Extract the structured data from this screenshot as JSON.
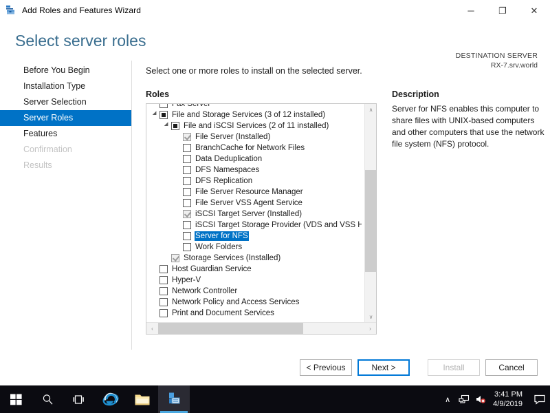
{
  "window": {
    "title": "Add Roles and Features Wizard",
    "icon": "wizard-toolbox-icon",
    "controls": {
      "minimize": "─",
      "restore": "❐",
      "close": "✕"
    }
  },
  "header": {
    "page_title": "Select server roles",
    "destination_label": "DESTINATION SERVER",
    "destination_value": "RX-7.srv.world"
  },
  "sidebar": {
    "items": [
      {
        "label": "Before You Begin",
        "state": "normal"
      },
      {
        "label": "Installation Type",
        "state": "normal"
      },
      {
        "label": "Server Selection",
        "state": "normal"
      },
      {
        "label": "Server Roles",
        "state": "active"
      },
      {
        "label": "Features",
        "state": "normal"
      },
      {
        "label": "Confirmation",
        "state": "disabled"
      },
      {
        "label": "Results",
        "state": "disabled"
      }
    ],
    "active_color": "#0072c6"
  },
  "main": {
    "instruction": "Select one or more roles to install on the selected server.",
    "roles_heading": "Roles",
    "description_heading": "Description",
    "description_text": "Server for NFS enables this computer to share files with UNIX-based computers and other computers that use the network file system (NFS) protocol.",
    "selection_color": "#0072c6"
  },
  "roles_tree": [
    {
      "label": "Fax Server",
      "indent": 0,
      "check": "empty",
      "twisty": false,
      "selected": false,
      "clipped_top": true
    },
    {
      "label": "File and Storage Services (3 of 12 installed)",
      "indent": 0,
      "check": "partial",
      "twisty": true,
      "selected": false
    },
    {
      "label": "File and iSCSI Services (2 of 11 installed)",
      "indent": 1,
      "check": "partial",
      "twisty": true,
      "selected": false
    },
    {
      "label": "File Server (Installed)",
      "indent": 2,
      "check": "installed",
      "twisty": false,
      "selected": false
    },
    {
      "label": "BranchCache for Network Files",
      "indent": 2,
      "check": "empty",
      "twisty": false,
      "selected": false
    },
    {
      "label": "Data Deduplication",
      "indent": 2,
      "check": "empty",
      "twisty": false,
      "selected": false
    },
    {
      "label": "DFS Namespaces",
      "indent": 2,
      "check": "empty",
      "twisty": false,
      "selected": false
    },
    {
      "label": "DFS Replication",
      "indent": 2,
      "check": "empty",
      "twisty": false,
      "selected": false
    },
    {
      "label": "File Server Resource Manager",
      "indent": 2,
      "check": "empty",
      "twisty": false,
      "selected": false
    },
    {
      "label": "File Server VSS Agent Service",
      "indent": 2,
      "check": "empty",
      "twisty": false,
      "selected": false
    },
    {
      "label": "iSCSI Target Server (Installed)",
      "indent": 2,
      "check": "installed",
      "twisty": false,
      "selected": false
    },
    {
      "label": "iSCSI Target Storage Provider (VDS and VSS Hardware Providers)",
      "indent": 2,
      "check": "empty",
      "twisty": false,
      "selected": false
    },
    {
      "label": "Server for NFS",
      "indent": 2,
      "check": "empty",
      "twisty": false,
      "selected": true
    },
    {
      "label": "Work Folders",
      "indent": 2,
      "check": "empty",
      "twisty": false,
      "selected": false
    },
    {
      "label": "Storage Services (Installed)",
      "indent": 1,
      "check": "installed",
      "twisty": false,
      "selected": false
    },
    {
      "label": "Host Guardian Service",
      "indent": 0,
      "check": "empty",
      "twisty": false,
      "selected": false
    },
    {
      "label": "Hyper-V",
      "indent": 0,
      "check": "empty",
      "twisty": false,
      "selected": false
    },
    {
      "label": "Network Controller",
      "indent": 0,
      "check": "empty",
      "twisty": false,
      "selected": false
    },
    {
      "label": "Network Policy and Access Services",
      "indent": 0,
      "check": "empty",
      "twisty": false,
      "selected": false
    },
    {
      "label": "Print and Document Services",
      "indent": 0,
      "check": "empty",
      "twisty": false,
      "selected": false
    }
  ],
  "scrollbars": {
    "vertical_up": "∧",
    "vertical_down": "∨",
    "horizontal_left": "‹",
    "horizontal_right": "›"
  },
  "footer": {
    "buttons": [
      {
        "label": "< Previous",
        "state": "normal"
      },
      {
        "label": "Next >",
        "state": "focused"
      },
      {
        "label": "Install",
        "state": "disabled"
      },
      {
        "label": "Cancel",
        "state": "normal"
      }
    ]
  },
  "taskbar": {
    "start": "start-button",
    "search": "search-icon",
    "task_view": "task-view-icon",
    "apps": [
      {
        "name": "internet-explorer-icon",
        "active": false
      },
      {
        "name": "file-explorer-icon",
        "active": false
      },
      {
        "name": "server-manager-icon",
        "active": true
      }
    ],
    "tray": {
      "chevron": "∧",
      "network": "network-icon",
      "volume": "volume-muted-icon",
      "time": "3:41 PM",
      "date": "4/9/2019",
      "action_center": "action-center-icon"
    }
  }
}
